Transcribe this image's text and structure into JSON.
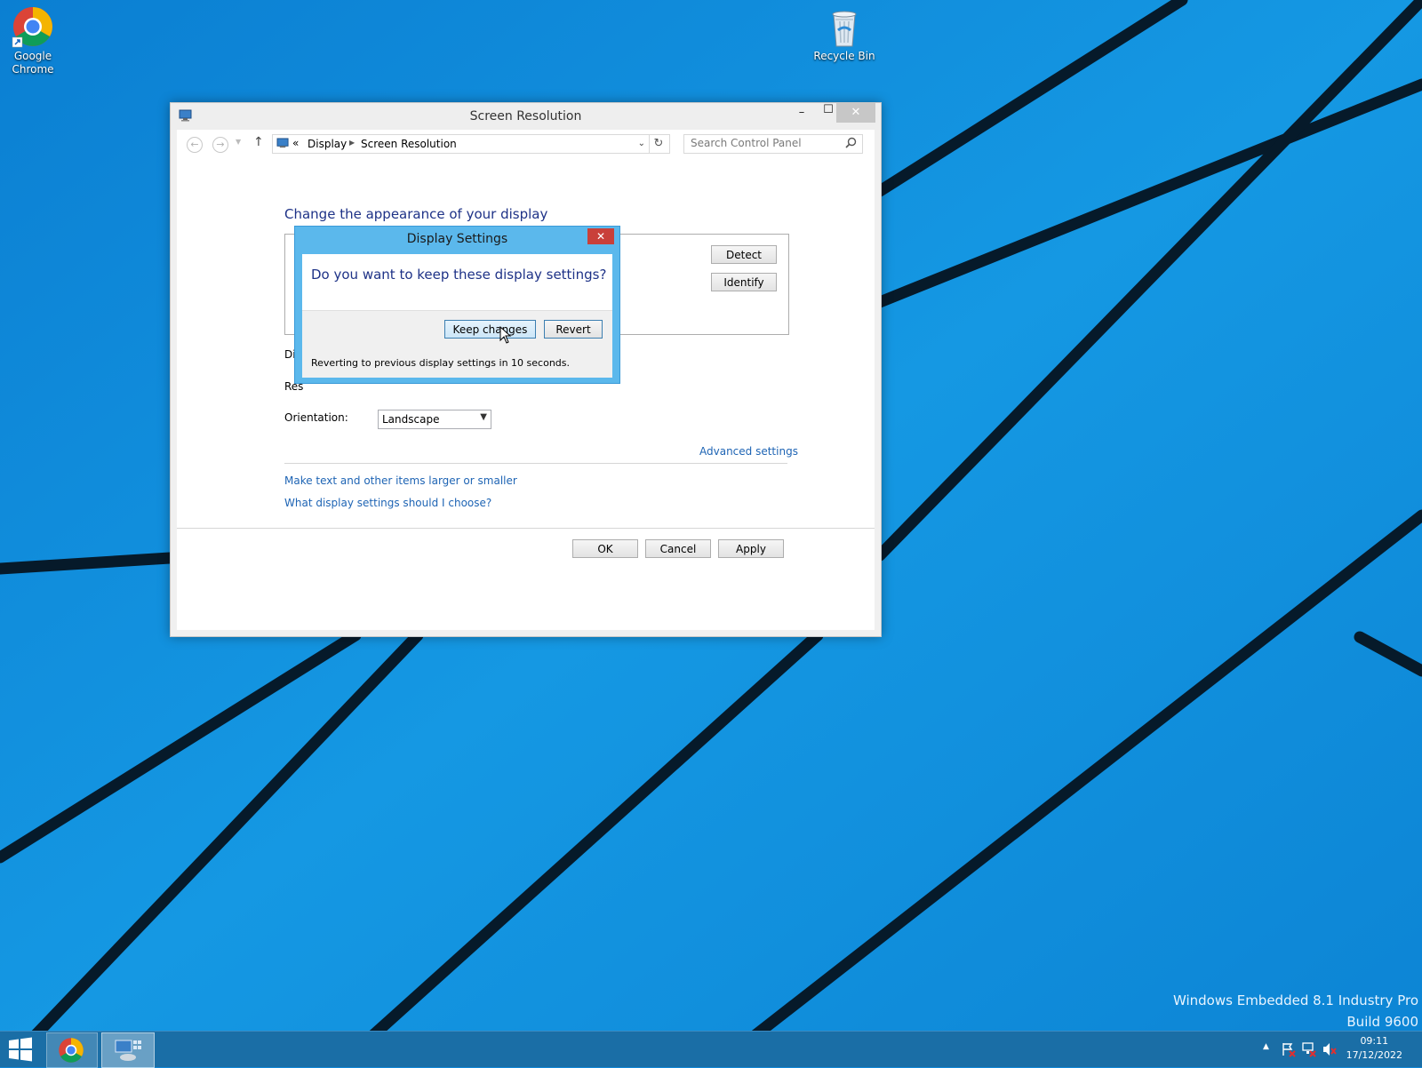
{
  "desktop": {
    "icons": [
      {
        "label_line1": "Google",
        "label_line2": "Chrome",
        "icon": "google-chrome-icon"
      },
      {
        "label_line1": "Recycle Bin",
        "icon": "recycle-bin-icon"
      }
    ],
    "watermark": {
      "edition": "Windows Embedded 8.1 Industry Pro",
      "build": "Build 9600"
    }
  },
  "window": {
    "title": "Screen Resolution",
    "controls": {
      "minimize": "–",
      "maximize": "☐",
      "close": "✕"
    },
    "nav": {
      "back_icon": "back-arrow-icon",
      "forward_icon": "forward-arrow-icon",
      "up_icon": "up-arrow-icon",
      "breadcrumb_prefix": "«",
      "breadcrumb": [
        "Display",
        "Screen Resolution"
      ],
      "search_placeholder": "Search Control Panel"
    },
    "heading": "Change the appearance of your display",
    "detect_label": "Detect",
    "identify_label": "Identify",
    "display_label_partial": "Dis",
    "resolution_label_partial": "Res",
    "orientation_label": "Orientation:",
    "orientation_value": "Landscape",
    "advanced_settings_link": "Advanced settings",
    "links": [
      "Make text and other items larger or smaller",
      "What display settings should I choose?"
    ],
    "buttons": {
      "ok": "OK",
      "cancel": "Cancel",
      "apply": "Apply"
    }
  },
  "dialog": {
    "title": "Display Settings",
    "close": "✕",
    "question": "Do you want to keep these display settings?",
    "keep_label": "Keep changes",
    "revert_label": "Revert",
    "countdown": "Reverting to previous display settings in 10 seconds."
  },
  "taskbar": {
    "time": "09:11",
    "date": "17/12/2022"
  },
  "colors": {
    "desktop": "#1289d8",
    "taskbar": "#1a6ea6",
    "dialog_frame": "#5bb8ec",
    "link": "#1e64b4",
    "heading": "#1e3287",
    "close_red": "#c9403a"
  }
}
